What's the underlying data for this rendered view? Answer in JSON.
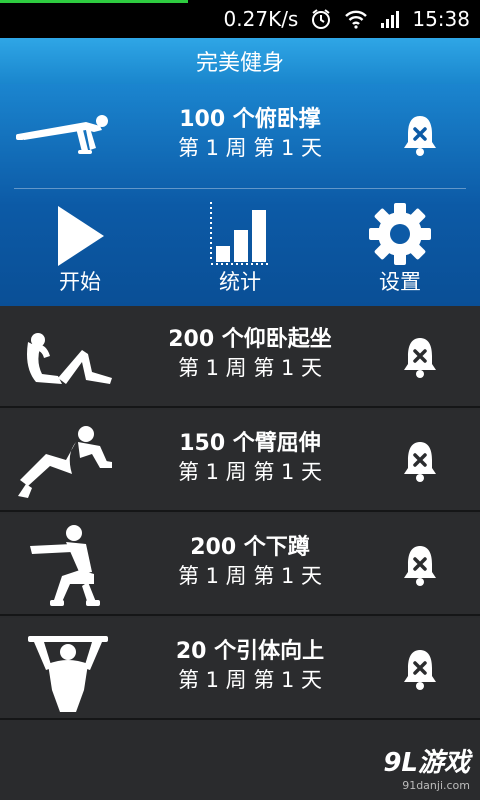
{
  "status_bar": {
    "speed": "0.27K/s",
    "time": "15:38"
  },
  "app": {
    "title": "完美健身"
  },
  "featured": {
    "title": "100 个俯卧撑",
    "progress": "第 1 周 第 1 天"
  },
  "actions": [
    {
      "label": "开始",
      "icon": "play-icon"
    },
    {
      "label": "统计",
      "icon": "bar-chart-icon"
    },
    {
      "label": "设置",
      "icon": "gear-icon"
    }
  ],
  "exercises": [
    {
      "title": "200 个仰卧起坐",
      "progress": "第 1 周 第 1 天",
      "icon": "situp-figure-icon"
    },
    {
      "title": "150 个臂屈伸",
      "progress": "第 1 周 第 1 天",
      "icon": "dip-figure-icon"
    },
    {
      "title": "200 个下蹲",
      "progress": "第 1 周 第 1 天",
      "icon": "squat-figure-icon"
    },
    {
      "title": "20 个引体向上",
      "progress": "第 1 周 第 1 天",
      "icon": "pullup-figure-icon"
    }
  ],
  "watermark": {
    "logo": "9L游戏",
    "site": "91danji.com"
  },
  "colors": {
    "accent": "#1a86cd",
    "hero": "#0c5aa6",
    "list_bg": "#2b2c2e"
  }
}
